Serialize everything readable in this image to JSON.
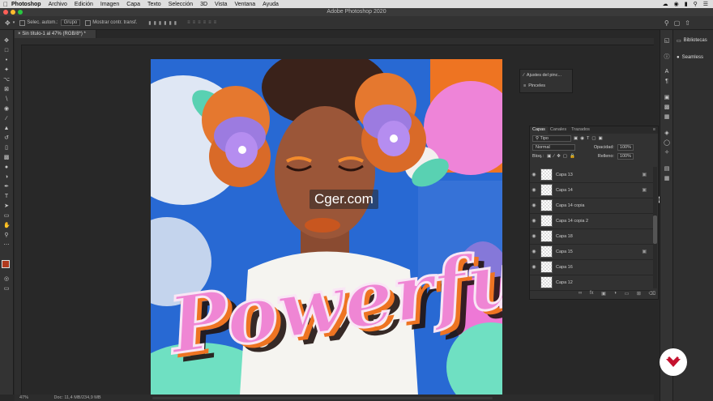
{
  "menubar": {
    "items": [
      "Photoshop",
      "Archivo",
      "Edición",
      "Imagen",
      "Capa",
      "Texto",
      "Selección",
      "3D",
      "Vista",
      "Ventana",
      "Ayuda"
    ]
  },
  "window": {
    "title": "Adobe Photoshop 2020"
  },
  "options": {
    "auto_select": "Selec. autom.:",
    "group": "Grupo",
    "transform": "Mostrar contr. transf."
  },
  "document": {
    "tab": "Sin título-1 al 47% (RGB/8*) *"
  },
  "status": {
    "zoom": "47%",
    "doc": "Doc: 11,4 MB/234,9 MB"
  },
  "dock": {
    "items": [
      {
        "label": "Bibliotecas",
        "icon": "libraries-icon"
      },
      {
        "label": "Seamless",
        "icon": "seamless-icon"
      }
    ]
  },
  "brush_panel": {
    "items": [
      {
        "label": "Ajustes del pinc...",
        "icon": "brush-settings-icon"
      },
      {
        "label": "Pinceles",
        "icon": "brushes-icon"
      }
    ]
  },
  "layers": {
    "tabs": [
      "Capas",
      "Canales",
      "Trazados"
    ],
    "filter": "Tipo",
    "blend_mode": "Normal",
    "opacity_label": "Opacidad:",
    "opacity_value": "100%",
    "lock_label": "Bloq.:",
    "fill_label": "Relleno:",
    "fill_value": "100%",
    "rows": [
      {
        "name": "Capa 13",
        "locked": true
      },
      {
        "name": "Capa 14",
        "locked": true
      },
      {
        "name": "Capa 14 copia",
        "locked": false
      },
      {
        "name": "Capa 14 copia 2",
        "locked": false
      },
      {
        "name": "Capa 18",
        "locked": false
      },
      {
        "name": "Capa 15",
        "locked": true
      },
      {
        "name": "Capa 16",
        "locked": false
      },
      {
        "name": "Capa 12",
        "locked": false
      }
    ]
  },
  "artwork": {
    "lettering": "Powerful"
  },
  "watermark": "Cger.com",
  "colors": {
    "accent": "#1473e6",
    "foreground": "#b03a1e",
    "background": "#ffffff",
    "fab": "#c4112e"
  }
}
